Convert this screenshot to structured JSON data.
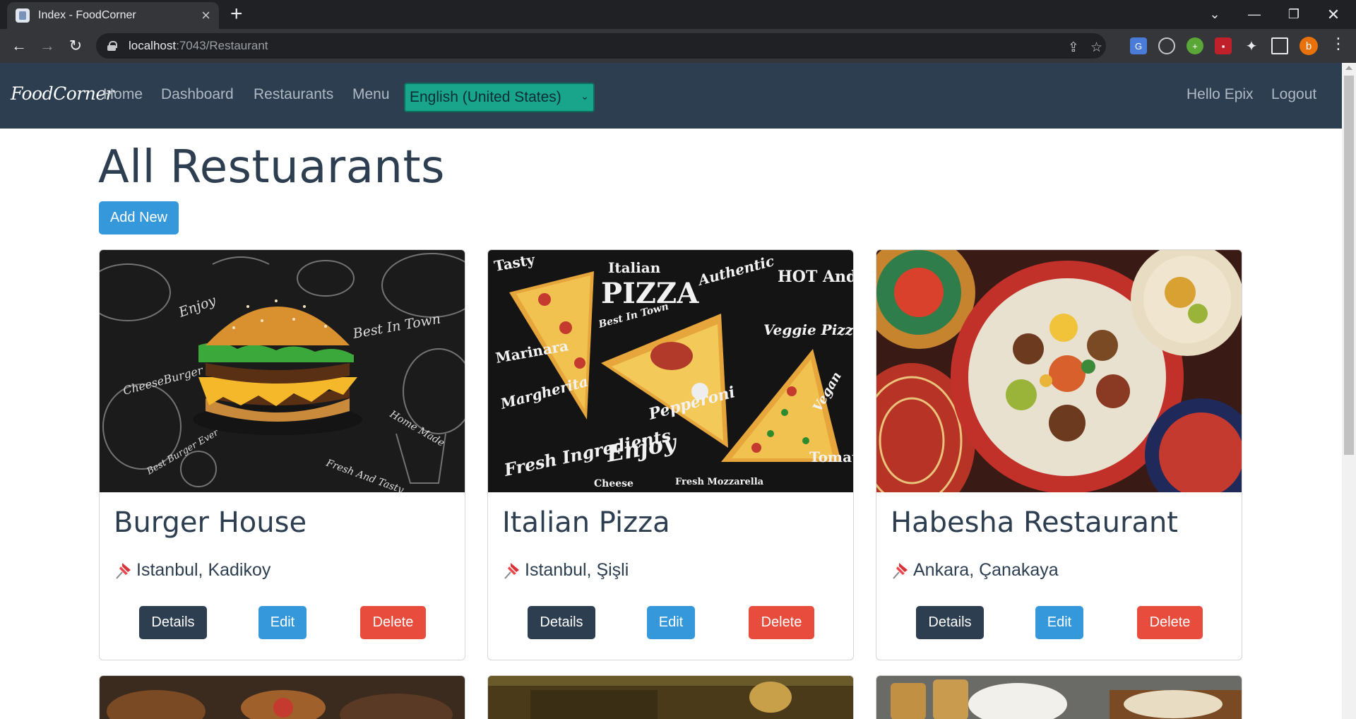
{
  "browser": {
    "tab_title": "Index - FoodCorner",
    "new_tab_symbol": "+",
    "url_host": "localhost",
    "url_path": ":7043/Restaurant",
    "profile_initial": "b"
  },
  "navbar": {
    "brand": "FoodCorner",
    "links": [
      "Home",
      "Dashboard",
      "Restaurants",
      "Menu"
    ],
    "language_selected": "English (United States)",
    "greeting": "Hello Epix",
    "logout": "Logout"
  },
  "main": {
    "title": "All Restuarants",
    "add_new_label": "Add New",
    "restaurants": [
      {
        "name": "Burger House",
        "location": "Istanbul, Kadikoy",
        "image": "burger-chalkboard"
      },
      {
        "name": "Italian Pizza",
        "location": "Istanbul, Şişli",
        "image": "pizza-chalkboard"
      },
      {
        "name": "Habesha Restaurant",
        "location": "Ankara, Çanakaya",
        "image": "ethiopian-platter"
      }
    ],
    "actions": {
      "details": "Details",
      "edit": "Edit",
      "delete": "Delete"
    }
  },
  "image_text": {
    "burger": [
      "Enjoy",
      "Best In Town",
      "CheeseBurger",
      "Home Made",
      "Best Burger Ever",
      "Fresh And Tasty"
    ],
    "pizza": [
      "Tasty",
      "Italian",
      "PIZZA",
      "Authentic",
      "HOT And Fresh",
      "Best In Town",
      "Veggie Pizza",
      "Marinara",
      "Margherita",
      "Pepperoni",
      "Vegan",
      "Fresh Ingredients",
      "Enjoy",
      "Tomato",
      "Cheese",
      "Fresh Mozzarella"
    ]
  },
  "colors": {
    "navbar_bg": "#2c3e50",
    "primary": "#3498db",
    "danger": "#e74c3c",
    "dark": "#2c3e50",
    "language_select_bg": "#18a58b"
  }
}
